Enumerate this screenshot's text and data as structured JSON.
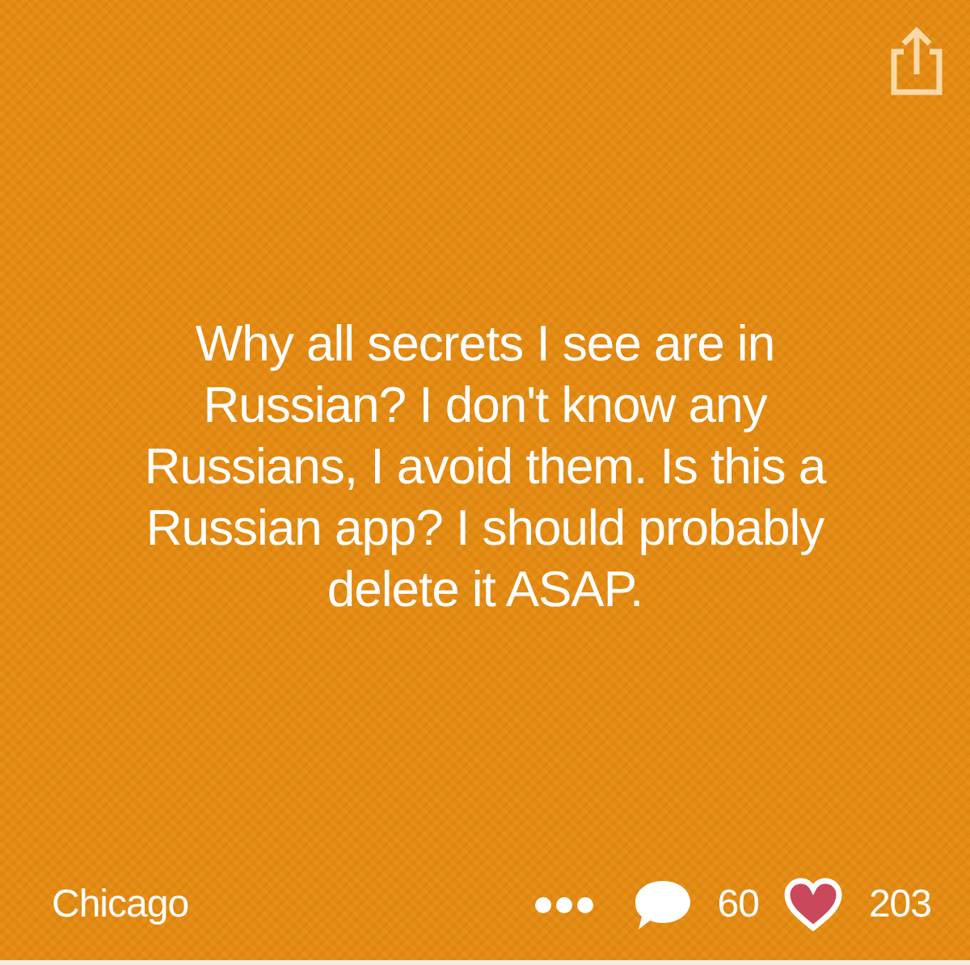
{
  "message": "Why all secrets I see are in Russian? I don't know any Russians, I avoid them. Is this a Russian app? I should probably delete it ASAP.",
  "footer": {
    "location": "Chicago",
    "replies": "60",
    "likes": "203",
    "liked": true
  }
}
